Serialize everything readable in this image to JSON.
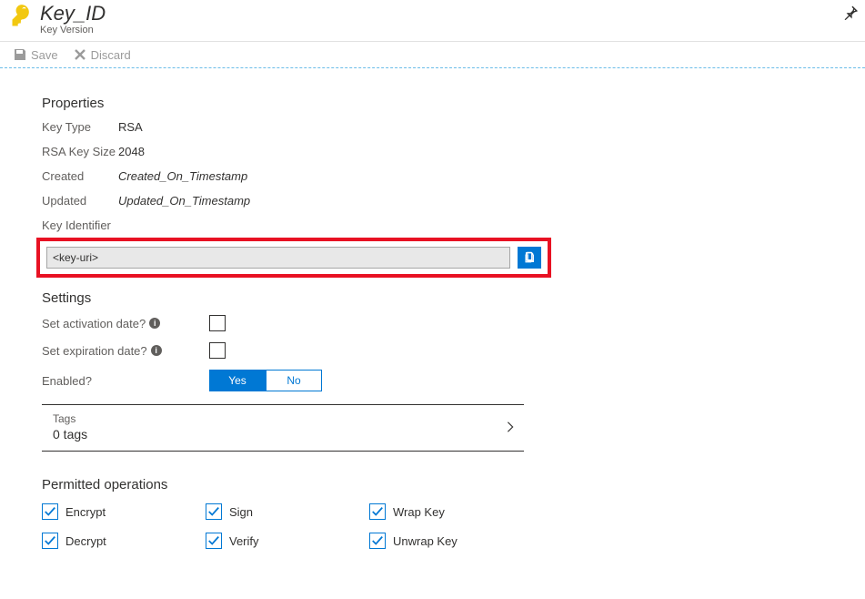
{
  "header": {
    "title": "Key_ID",
    "subtitle": "Key Version"
  },
  "toolbar": {
    "save_label": "Save",
    "discard_label": "Discard"
  },
  "properties": {
    "section_title": "Properties",
    "key_type_label": "Key Type",
    "key_type_value": "RSA",
    "rsa_size_label": "RSA Key Size",
    "rsa_size_value": "2048",
    "created_label": "Created",
    "created_value": "Created_On_Timestamp",
    "updated_label": "Updated",
    "updated_value": "Updated_On_Timestamp",
    "identifier_label": "Key Identifier",
    "identifier_value": "<key-uri>"
  },
  "settings": {
    "section_title": "Settings",
    "activation_label": "Set activation date?",
    "expiration_label": "Set expiration date?",
    "enabled_label": "Enabled?",
    "yes_label": "Yes",
    "no_label": "No"
  },
  "tags": {
    "title": "Tags",
    "count": "0 tags"
  },
  "permitted": {
    "section_title": "Permitted operations",
    "ops": [
      "Encrypt",
      "Sign",
      "Wrap Key",
      "Decrypt",
      "Verify",
      "Unwrap Key"
    ]
  }
}
